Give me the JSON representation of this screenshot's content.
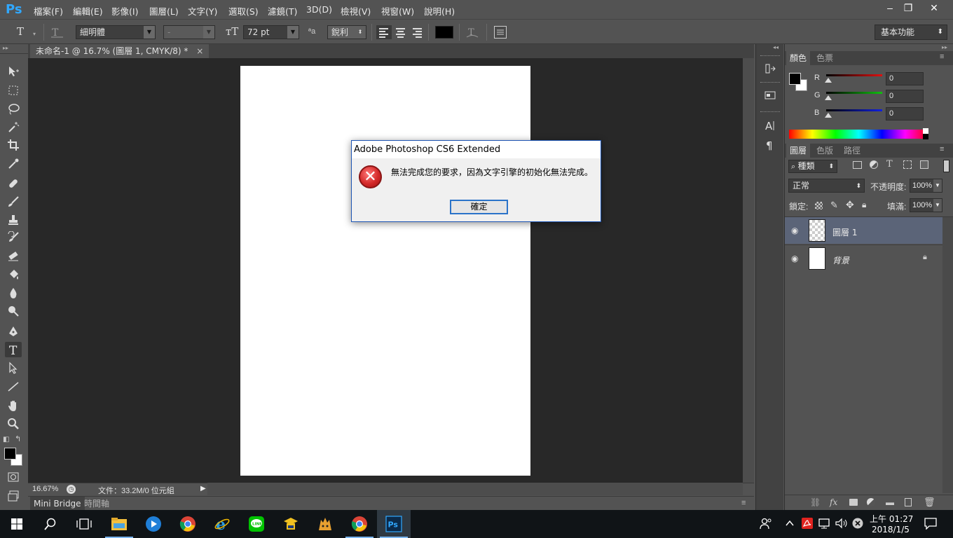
{
  "app": {
    "logo": "Ps",
    "menu": [
      "檔案(F)",
      "編輯(E)",
      "影像(I)",
      "圖層(L)",
      "文字(Y)",
      "選取(S)",
      "濾鏡(T)",
      "3D(D)",
      "檢視(V)",
      "視窗(W)",
      "說明(H)"
    ],
    "window_controls": {
      "minimize": "–",
      "restore": "❐",
      "close": "✕"
    }
  },
  "options_bar": {
    "tool_icon": "T",
    "font_family": "細明體",
    "font_style": "-",
    "font_size": "72 pt",
    "antialias_icon": "ªa",
    "antialias": "銳利",
    "text_color": "#000000",
    "workspace": "基本功能"
  },
  "document": {
    "tab_title": "未命名-1 @ 16.7% (圖層 1, CMYK/8) *",
    "tab_close": "×",
    "zoom": "16.67%",
    "file_info": "文件：33.2M/0 位元組",
    "bottom_tabs": [
      "Mini Bridge",
      "時間軸"
    ]
  },
  "dialog": {
    "title": "Adobe Photoshop CS6 Extended",
    "icon": "error-icon",
    "message": "無法完成您的要求，因為文字引擎的初始化無法完成。",
    "ok_label": "確定"
  },
  "color_panel": {
    "tabs": [
      "顏色",
      "色票"
    ],
    "channels": [
      {
        "label": "R",
        "value": "0",
        "color": "#d01c1c"
      },
      {
        "label": "G",
        "value": "0",
        "color": "#1ca81c"
      },
      {
        "label": "B",
        "value": "0",
        "color": "#1c2ad0"
      }
    ]
  },
  "layers_panel": {
    "tabs": [
      "圖層",
      "色版",
      "路徑"
    ],
    "filter_kind": "種類",
    "blend_mode": "正常",
    "opacity_label": "不透明度:",
    "opacity": "100%",
    "lock_label": "鎖定:",
    "fill_label": "填滿:",
    "fill": "100%",
    "layers": [
      {
        "name": "圖層 1",
        "selected": true,
        "transparent": true
      },
      {
        "name": "背景",
        "selected": false,
        "transparent": false,
        "locked": true
      }
    ]
  },
  "taskbar": {
    "clock_time": "上午 01:27",
    "clock_date": "2018/1/5"
  }
}
